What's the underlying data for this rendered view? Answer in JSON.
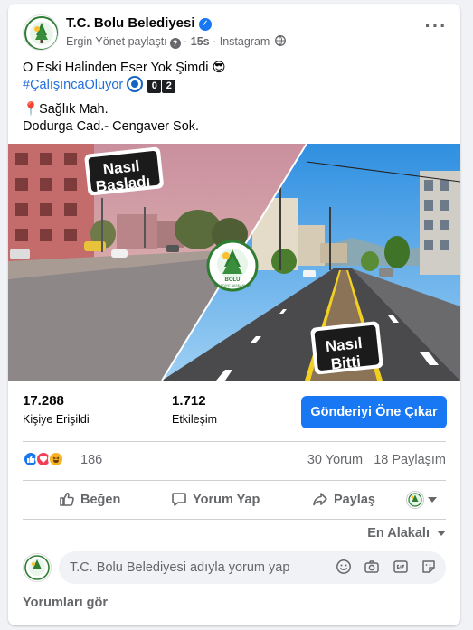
{
  "post": {
    "page_name": "T.C. Bolu Belediyesi",
    "author_line": "Ergin Yönet paylaştı",
    "time": "15s",
    "source": "Instagram",
    "caption_line1": "O Eski Halinden Eser Yok Şimdi 😎",
    "hashtag": "#ÇalışıncaOluyor",
    "key1": "0",
    "key2": "2",
    "location_line1": "Sağlık Mah.",
    "location_line2": "Dodurga Cad.- Cengaver Sok."
  },
  "media": {
    "before_label_1": "Nasıl",
    "before_label_2": "Başladı",
    "after_label_1": "Nasıl",
    "after_label_2": "Bitti",
    "logo_text": "BOLU",
    "logo_subtext": "BELEDİYE BAŞKANLIĞI"
  },
  "stats": {
    "reach_value": "17.288",
    "reach_label": "Kişiye Erişildi",
    "engagement_value": "1.712",
    "engagement_label": "Etkileşim",
    "boost_label": "Gönderiyi Öne Çıkar"
  },
  "reactions": {
    "count": "186",
    "comments": "30 Yorum",
    "shares": "18 Paylaşım",
    "types": [
      "like-icon",
      "love-icon",
      "haha-icon"
    ]
  },
  "actions": {
    "like": "Beğen",
    "comment": "Yorum Yap",
    "share": "Paylaş"
  },
  "comments": {
    "sort_label": "En Alakalı",
    "placeholder": "T.C. Bolu Belediyesi adıyla yorum yap",
    "view_all": "Yorumları gör"
  },
  "colors": {
    "accent": "#1877f2",
    "hashtag": "#216fdb",
    "muted": "#65676b"
  }
}
